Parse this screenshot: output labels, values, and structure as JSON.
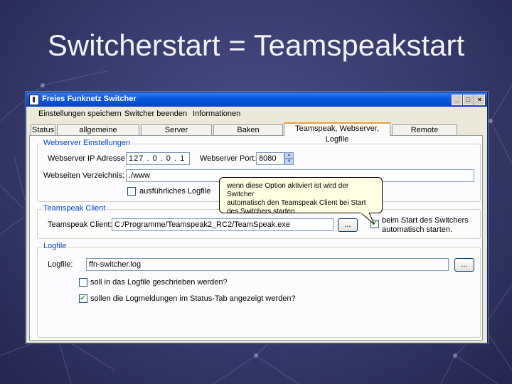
{
  "slide": {
    "title": "Switcherstart = Teamspeakstart"
  },
  "window": {
    "title": "Freies Funknetz Switcher",
    "controls": {
      "minimize": "_",
      "maximize": "□",
      "close": "×"
    }
  },
  "menu": [
    "Einstellungen speichern",
    "Switcher beenden",
    "Informationen"
  ],
  "tabs": [
    "Status",
    "allgemeine Einstellungen",
    "Server Einstellungen",
    "Baken Einstellungen",
    "Teamspeak, Webserver, Logfile",
    "Remote Steuerung"
  ],
  "webserver": {
    "legend": "Webserver Einstellungen",
    "ip_label": "Webserver IP Adresse:",
    "ip_value": "127 . 0 . 0 . 1",
    "port_label": "Webserver Port:",
    "port_value": "8080",
    "dir_label": "Webseiten Verzeichnis:",
    "dir_value": "./www",
    "verbose_label": "ausführliches Logfile",
    "verbose_checked": false
  },
  "teamspeak": {
    "legend": "Teamspeak Client",
    "client_label": "Teamspeak Client:",
    "client_value": "C:/Programme/Teamspeak2_RC2/TeamSpeak.exe",
    "browse_label": "...",
    "autostart_label_1": "beim Start des Switchers",
    "autostart_label_2": "automatisch starten.",
    "autostart_checked": true
  },
  "tooltip": {
    "line1": "wenn diese Option aktiviert ist wird der Switcher",
    "line2": "automatisch den Teamspeak Client bei Start",
    "line3": "des Switchers starten."
  },
  "logfile": {
    "legend": "Logfile",
    "file_label": "Logfile:",
    "file_value": "ffn-switcher.log",
    "browse_label": "...",
    "write_label": "soll in das Logfile geschrieben werden?",
    "write_checked": false,
    "show_label": "sollen die Logmeldungen im Status-Tab angezeigt werden?",
    "show_checked": true
  },
  "icons": {
    "check": "✓",
    "spin_up": "▲",
    "spin_down": "▼"
  },
  "colors": {
    "titlebar": "#0a5ae0",
    "group_legend": "#0046d5",
    "active_tab_accent": "#e6a23c",
    "tooltip_bg": "#ffffe1"
  }
}
